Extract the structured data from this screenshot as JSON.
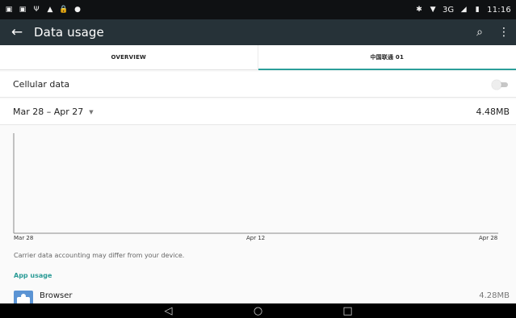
{
  "status_bar": {
    "left_icons": [
      "photo-icon",
      "photo-icon",
      "usb-icon",
      "warning-icon",
      "lock-icon",
      "location-icon"
    ],
    "right_icons": [
      "bluetooth-icon",
      "wifi-icon",
      "signal-icon",
      "battery-icon"
    ],
    "network": "3G",
    "time": "11:16"
  },
  "toolbar": {
    "back_icon": "arrow-left-icon",
    "title": "Data usage",
    "search_icon": "search-icon",
    "more_icon": "more-vert-icon"
  },
  "tabs": [
    {
      "label": "OVERVIEW",
      "active": false
    },
    {
      "label": "中国联通 01",
      "active": true
    }
  ],
  "cellular": {
    "label": "Cellular data",
    "enabled": false
  },
  "date_range": {
    "label": "Mar 28 – Apr 27",
    "value": "4.48MB"
  },
  "chart_labels": {
    "start": "Mar 28",
    "middle": "Apr 12",
    "end": "Apr 28"
  },
  "disclaimer": "Carrier data accounting may differ from your device.",
  "section": {
    "title": "App usage"
  },
  "apps": [
    {
      "name": "Browser",
      "size": "4.28MB",
      "icon": "browser-icon"
    }
  ],
  "nav_bar": {
    "back_icon": "back-triangle-icon",
    "home_icon": "home-circle-icon",
    "recents_icon": "recents-square-icon"
  },
  "colors": {
    "toolbar": "#263238",
    "accent": "#2b9e9a",
    "status_bar": "#0f1113",
    "nav_bar": "#000000"
  }
}
